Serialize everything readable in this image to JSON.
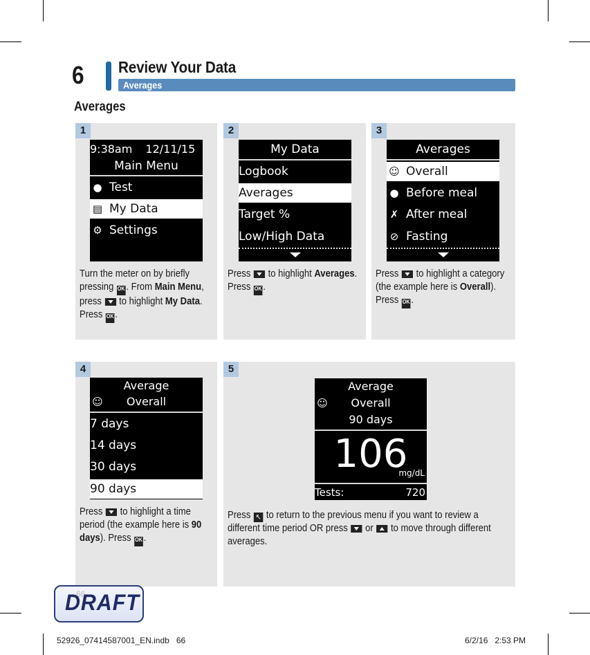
{
  "header": {
    "chapter_number": "6",
    "title": "Review Your Data",
    "subtitle": "Averages"
  },
  "section_heading": "Averages",
  "steps": [
    {
      "number": "1",
      "screen": {
        "time": "9:38am",
        "date": "12/11/15",
        "title": "Main Menu",
        "items": [
          {
            "icon": "drop-icon",
            "label": "Test",
            "highlighted": false
          },
          {
            "icon": "my-data-icon",
            "label": "My Data",
            "highlighted": true
          },
          {
            "icon": "gear-icon",
            "label": "Settings",
            "highlighted": false
          }
        ]
      },
      "text": {
        "t1": "Turn the meter on by briefly pressing ",
        "t2": ". From ",
        "b1": "Main Menu",
        "t3": ", press ",
        "t4": " to highlight ",
        "b2": "My Data",
        "t5": ". Press ",
        "t6": "."
      }
    },
    {
      "number": "2",
      "screen": {
        "title": "My Data",
        "items": [
          {
            "label": "Logbook",
            "highlighted": false
          },
          {
            "label": "Averages",
            "highlighted": true
          },
          {
            "label": "Target %",
            "highlighted": false
          },
          {
            "label": "Low/High Data",
            "highlighted": false
          }
        ]
      },
      "text": {
        "t1": "Press ",
        "t2": " to highlight ",
        "b1": "Averages",
        "t3": ". Press ",
        "t4": "."
      }
    },
    {
      "number": "3",
      "screen": {
        "title": "Averages",
        "items": [
          {
            "icon": "overall-icon",
            "label": "Overall",
            "highlighted": true
          },
          {
            "icon": "apple-icon",
            "label": "Before meal",
            "highlighted": false
          },
          {
            "icon": "apple-core-icon",
            "label": "After meal",
            "highlighted": false
          },
          {
            "icon": "no-meal-icon",
            "label": "Fasting",
            "highlighted": false
          }
        ]
      },
      "text": {
        "t1": "Press ",
        "t2": " to highlight a category (the example here is ",
        "b1": "Overall",
        "t3": "). Press ",
        "t4": "."
      }
    },
    {
      "number": "4",
      "screen": {
        "title_line1": "Average",
        "title_line2": "Overall",
        "items": [
          {
            "label": "7 days",
            "highlighted": false
          },
          {
            "label": "14 days",
            "highlighted": false
          },
          {
            "label": "30 days",
            "highlighted": false
          },
          {
            "label": "90 days",
            "highlighted": true
          }
        ]
      },
      "text": {
        "t1": "Press ",
        "t2": " to highlight a time period (the example here is ",
        "b1": "90 days",
        "t3": "). Press ",
        "t4": "."
      }
    },
    {
      "number": "5",
      "screen": {
        "title_line1": "Average",
        "title_line2": "Overall",
        "title_line3": "90 days",
        "value": "106",
        "unit": "mg/dL",
        "tests_label": "Tests:",
        "tests_value": "720"
      },
      "text": {
        "t1": "Press ",
        "t2": " to return to the previous menu if you want to review a different time period OR press ",
        "t3": " or ",
        "t4": " to move through different averages."
      }
    }
  ],
  "keys": {
    "ok_label": "OK",
    "back_glyph": "↖"
  },
  "draft_stamp": {
    "label": "DRAFT",
    "page_number": "66"
  },
  "footer": {
    "file": "52926_07414587001_EN.indb   66",
    "datetime": "6/2/16   2:53 PM"
  }
}
